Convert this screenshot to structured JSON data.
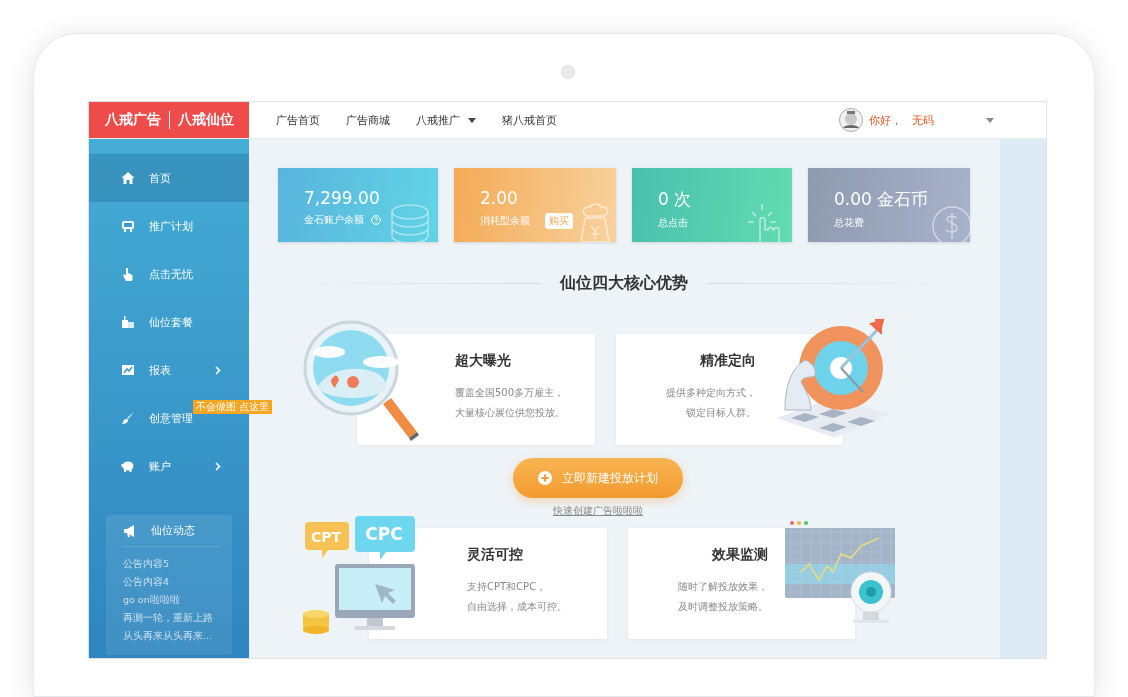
{
  "logo": {
    "brand": "八戒广告",
    "product": "八戒仙位"
  },
  "nav": [
    {
      "label": "广告首页",
      "has_menu": false
    },
    {
      "label": "广告商城",
      "has_menu": false
    },
    {
      "label": "八戒推广",
      "has_menu": true
    },
    {
      "label": "猪八戒首页",
      "has_menu": false
    }
  ],
  "user": {
    "greeting": "你好，",
    "name": "无码"
  },
  "sidebar": {
    "items": [
      {
        "label": "首页",
        "selected": true,
        "submenu": false
      },
      {
        "label": "推广计划",
        "selected": false,
        "submenu": false
      },
      {
        "label": "点击无忧",
        "selected": false,
        "submenu": false
      },
      {
        "label": "仙位套餐",
        "selected": false,
        "submenu": false
      },
      {
        "label": "报表",
        "selected": false,
        "submenu": true
      },
      {
        "label": "创意管理",
        "selected": false,
        "submenu": false,
        "badge": "不会做图 点这里"
      },
      {
        "label": "账户",
        "selected": false,
        "submenu": true
      }
    ],
    "news": {
      "title": "仙位动态",
      "items": [
        "公告内容5",
        "公告内容4",
        "go on啦啦啦",
        "再测一轮，重新上路",
        "从头再来从头再来..."
      ]
    }
  },
  "stats": [
    {
      "value": "7,299.00",
      "label": "金石账户余额",
      "kind": "balance",
      "help": true
    },
    {
      "value": "2.00",
      "label": "消耗型余额",
      "kind": "consume",
      "help": false,
      "button": "购买"
    },
    {
      "value": "0 次",
      "label": "总点击",
      "kind": "clicks",
      "help": false
    },
    {
      "value": "0.00 金石币",
      "label": "总花费",
      "kind": "spend",
      "help": false
    }
  ],
  "advantages": {
    "title": "仙位四大核心优势",
    "features": [
      {
        "kind": "exposure",
        "title": "超大曝光",
        "lines": [
          "覆盖全国500多万雇主，",
          "大量核心展位供您投放。"
        ]
      },
      {
        "kind": "targeting",
        "title": "精准定向",
        "lines": [
          "提供多种定向方式，",
          "锁定目标人群。"
        ]
      },
      {
        "kind": "control",
        "title": "灵活可控",
        "lines": [
          "支持CPT和CPC，",
          "自由选择，成本可控。"
        ],
        "tags": [
          "CPT",
          "CPC"
        ]
      },
      {
        "kind": "monitoring",
        "title": "效果监测",
        "lines": [
          "随时了解投放效果，",
          "及时调整投放策略。"
        ]
      }
    ]
  },
  "cta": {
    "label": "立即新建投放计划",
    "link": "快速创建广告啦啦啦"
  }
}
